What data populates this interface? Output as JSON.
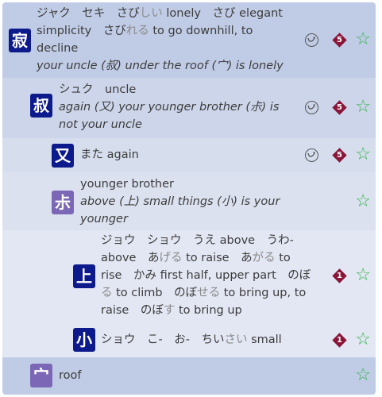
{
  "entries": [
    {
      "kanji": "寂",
      "lines": [
        [
          "ジャク　セキ　さび",
          "しい",
          " lonely　さび elegant"
        ],
        [
          "simplicity　さび",
          "れる",
          " to go downhill, to"
        ],
        [
          "decline"
        ]
      ],
      "meaning": "your uncle (叔) under the roof (宀) is lonely",
      "grade": "5",
      "star": "☆"
    },
    {
      "kanji": "叔",
      "lines": [
        [
          "シュク　uncle"
        ]
      ],
      "meaning_lines": [
        "again (又) your younger brother (尗) is",
        "not your uncle"
      ],
      "grade": "5",
      "star": "☆"
    },
    {
      "kanji": "又",
      "lines": [
        [
          "また again"
        ]
      ],
      "grade": "5",
      "star": "☆"
    },
    {
      "kanji": "尗",
      "lines": [
        [
          "younger brother"
        ]
      ],
      "meaning_lines": [
        "above (上) small things (小) is your younger",
        "brother"
      ],
      "star": "☆"
    },
    {
      "kanji": "上",
      "lines": [
        [
          "ジョウ　ショウ　うえ above　うわ-"
        ],
        [
          "above　あ",
          "げる",
          " to raise　あ",
          "がる",
          " to"
        ],
        [
          "rise　かみ first half, upper part　のぼ"
        ],
        [
          "",
          "る",
          " to climb　のぼ",
          "せる",
          " to bring up, to"
        ],
        [
          "raise　のぼ",
          "す",
          " to bring up"
        ]
      ],
      "grade": "1",
      "star": "☆"
    },
    {
      "kanji": "小",
      "lines": [
        [
          "ショウ　こ-　お-　ちい",
          "さい",
          " small"
        ]
      ],
      "grade": "1",
      "star": "☆"
    },
    {
      "kanji": "宀",
      "lines": [
        [
          "roof"
        ]
      ],
      "star": "☆"
    }
  ]
}
